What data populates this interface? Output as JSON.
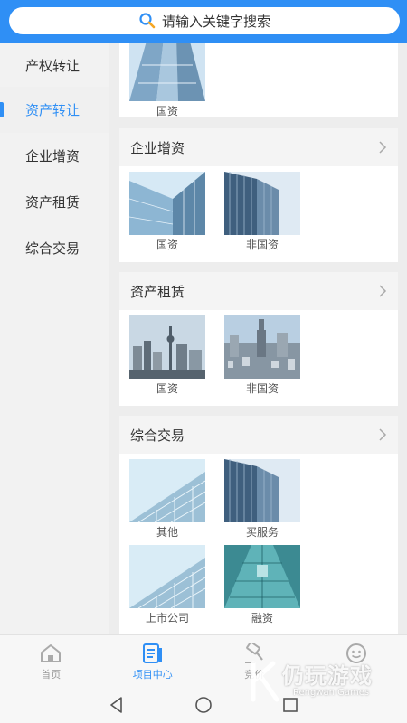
{
  "search": {
    "placeholder": "请输入关键字搜索"
  },
  "sidebar": {
    "items": [
      {
        "label": "产权转让",
        "active": false
      },
      {
        "label": "资产转让",
        "active": true
      },
      {
        "label": "企业增资",
        "active": false
      },
      {
        "label": "资产租赁",
        "active": false
      },
      {
        "label": "综合交易",
        "active": false
      }
    ]
  },
  "sections": [
    {
      "title": "",
      "tiles": [
        {
          "label": "国资"
        }
      ]
    },
    {
      "title": "企业增资",
      "tiles": [
        {
          "label": "国资"
        },
        {
          "label": "非国资"
        }
      ]
    },
    {
      "title": "资产租赁",
      "tiles": [
        {
          "label": "国资"
        },
        {
          "label": "非国资"
        }
      ]
    },
    {
      "title": "综合交易",
      "tiles": [
        {
          "label": "其他"
        },
        {
          "label": "买服务"
        },
        {
          "label": "上市公司"
        },
        {
          "label": "融资"
        }
      ]
    }
  ],
  "tabbar": {
    "tabs": [
      {
        "label": "首页",
        "icon": "home-icon"
      },
      {
        "label": "项目中心",
        "icon": "project-center-icon",
        "active": true
      },
      {
        "label": "竞价",
        "icon": "auction-hammer-icon"
      },
      {
        "label": "",
        "icon": "smile-icon"
      }
    ]
  },
  "watermark": {
    "title": "仍玩游戏",
    "subtitle": "Rengwan Games"
  },
  "colors": {
    "accent": "#2f8ff5",
    "background": "#f2f2f2"
  }
}
